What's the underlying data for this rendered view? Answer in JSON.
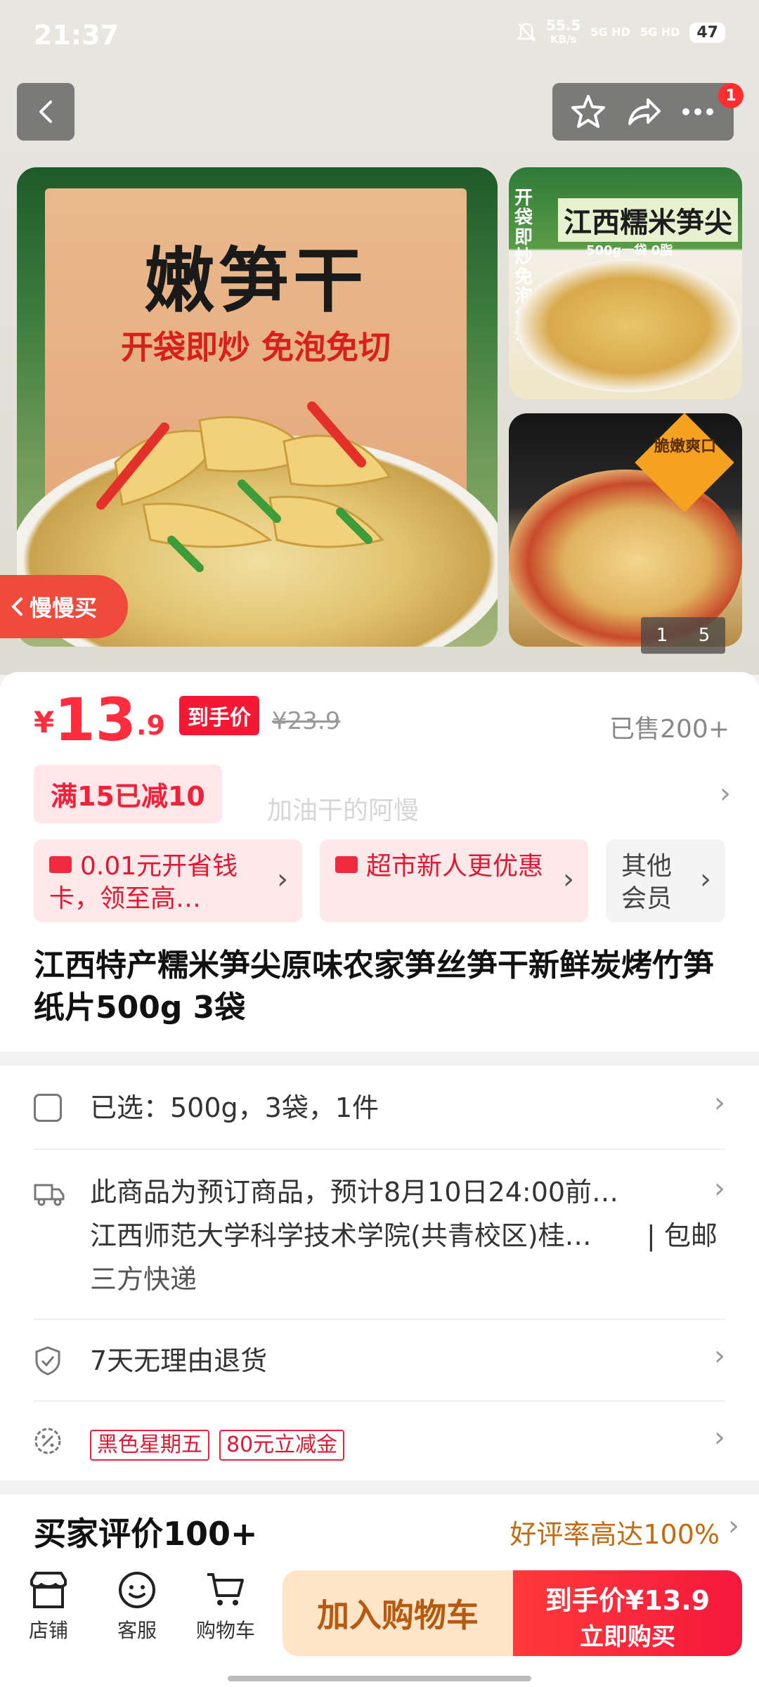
{
  "status_bar": {
    "time": "21:37",
    "net_speed": "55.5",
    "net_unit": "KB/s",
    "sig1": "5G HD",
    "sig2": "5G HD",
    "battery": "47"
  },
  "nav": {
    "badge_count": "1"
  },
  "gallery": {
    "main_title": "嫩笋干",
    "main_sub": "开袋即炒 免泡免切",
    "side1_title": "江西糯米笋尖",
    "side1_vertical": "开袋即炒免泡免切",
    "side1_sub": "500g一袋 0脂",
    "side2_badge": "脆嫩爽口",
    "counter_current": "1",
    "counter_total": "5",
    "slow_buy": "慢慢买"
  },
  "price": {
    "currency": "¥",
    "int": "13",
    "dec": ".9",
    "tag": "到手价",
    "original": "¥23.9",
    "sold": "已售200+",
    "promo": "满15已减10",
    "watermark": "加油干的阿慢"
  },
  "benefits": [
    {
      "label": "0.01元开省钱卡，领至高…"
    },
    {
      "label": "超市新人更优惠"
    },
    {
      "label": "其他会员"
    }
  ],
  "product_title": "江西特产糯米笋尖原味农家笋丝笋干新鲜炭烤竹笋纸片500g 3袋",
  "details": {
    "selected": "已选：500g，3袋，1件",
    "delivery_line1": "此商品为预订商品，预计8月10日24:00前…",
    "delivery_line2": "江西师范大学科学技术学院(共青校区)桂…",
    "delivery_free": "| 包邮",
    "delivery_line3": "三方快递",
    "returns": "7天无理由退货",
    "tag1": "黑色星期五",
    "tag2": "80元立减金"
  },
  "reviews": {
    "title": "买家评价100+",
    "rate": "好评率高达100%"
  },
  "bottom_bar": {
    "store": "店铺",
    "service": "客服",
    "cart": "购物车",
    "add_cart": "加入购物车",
    "buy_top": "到手价¥13.9",
    "buy_bottom": "立即购买"
  },
  "colors": {
    "accent_red": "#ff2d3d",
    "buy_button": "#f5183d",
    "cart_button": "#ffe4c8"
  }
}
